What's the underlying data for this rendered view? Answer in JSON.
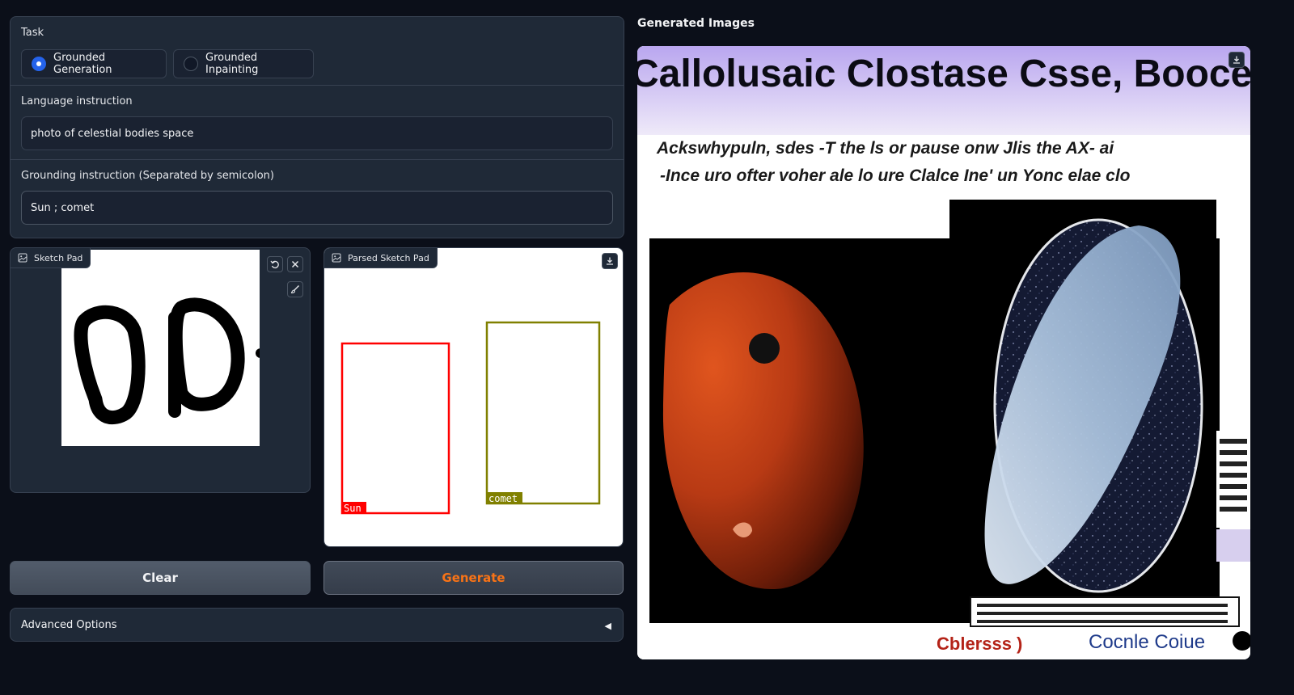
{
  "task": {
    "label": "Task",
    "options": [
      {
        "label": "Grounded Generation",
        "selected": true
      },
      {
        "label": "Grounded Inpainting",
        "selected": false
      }
    ]
  },
  "language": {
    "label": "Language instruction",
    "value": "photo of celestial bodies space"
  },
  "grounding": {
    "label": "Grounding instruction (Separated by semicolon)",
    "value": "Sun ; comet"
  },
  "sketch_pad": {
    "label": "Sketch Pad",
    "icons": [
      "image-icon",
      "undo-icon",
      "close-icon",
      "brush-icon"
    ]
  },
  "parsed_pad": {
    "label": "Parsed Sketch Pad",
    "boxes": [
      {
        "label": "Sun",
        "color": "#ff0000"
      },
      {
        "label": "comet",
        "color": "#808000"
      }
    ]
  },
  "buttons": {
    "clear": "Clear",
    "generate": "Generate"
  },
  "advanced": {
    "label": "Advanced Options",
    "arrow": "◀"
  },
  "output": {
    "title": "Generated Images",
    "image_text": {
      "headline": "Callolusaic Clostase Csse, Booce",
      "line1": "Ackswhypuln, sdes -T the ls or pause onw Jlis the AX- ai",
      "line2": "-Ince uro ofter voher ale lo ure Clalce Ine' un Yonc elae clo",
      "caption_left": "Cblersss )",
      "caption_right": "Cocnle Coiue"
    }
  },
  "colors": {
    "accent": "#2563eb",
    "generate_text": "#f97316",
    "background": "#0b0f19",
    "panel": "#1f2937"
  }
}
